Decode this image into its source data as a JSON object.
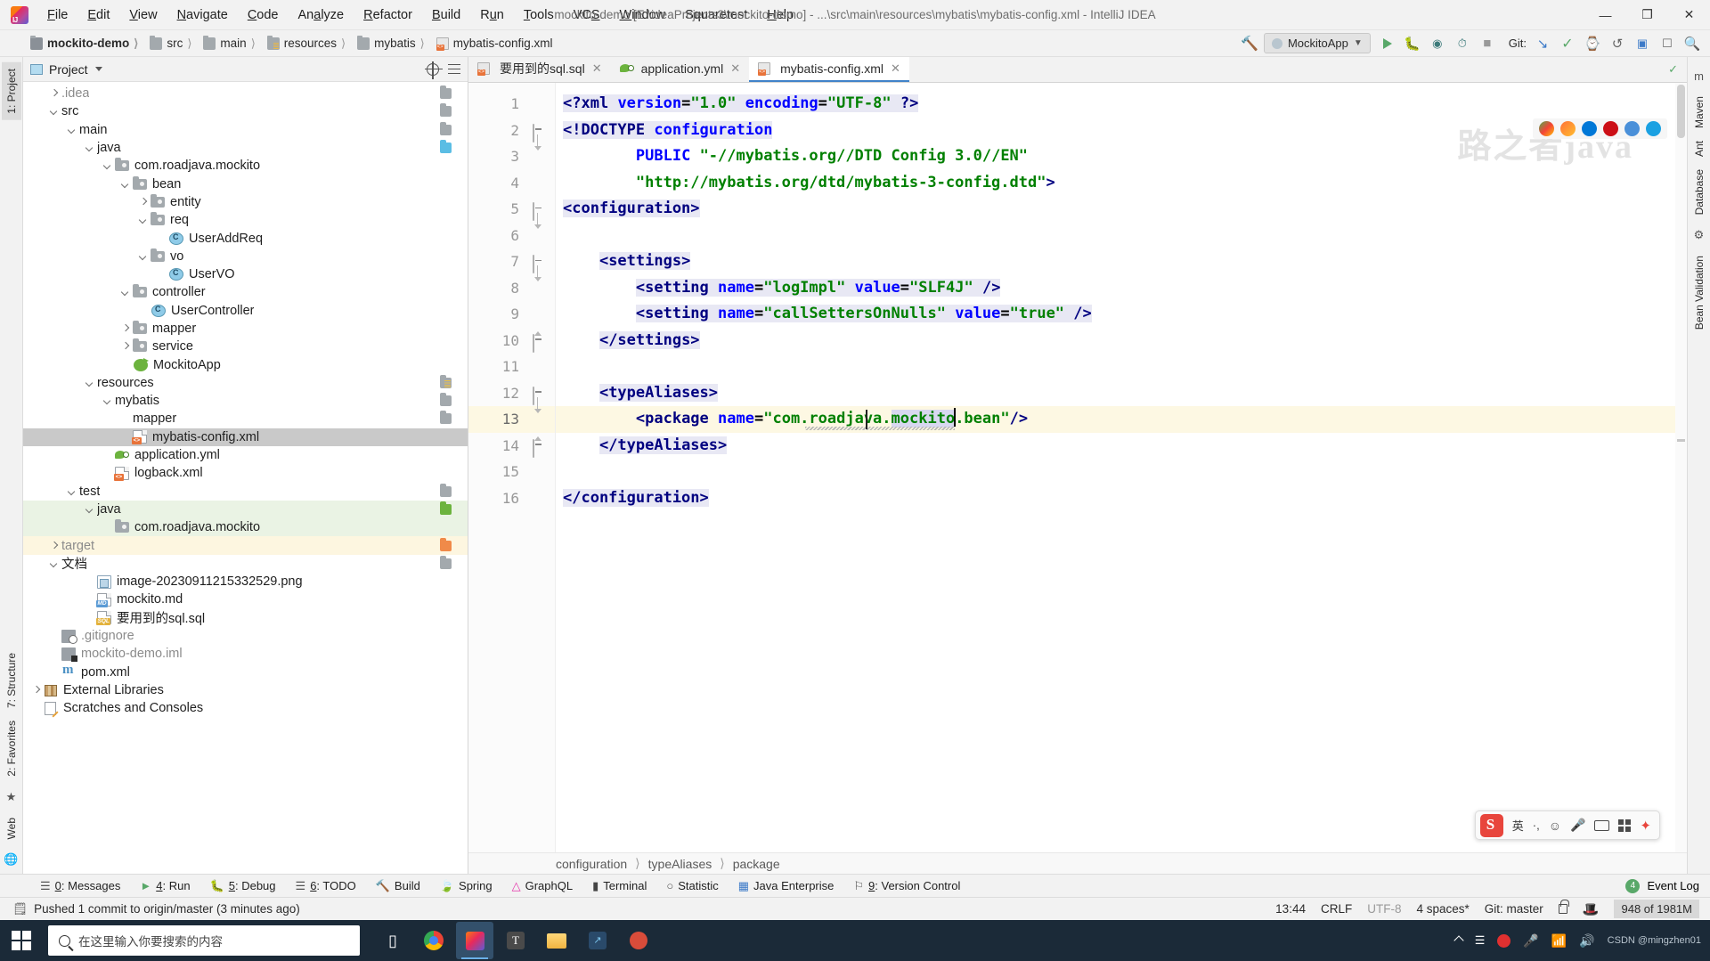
{
  "window": {
    "title": "mockito-demo [E:\\ideaProjects3\\mockito-demo] - ...\\src\\main\\resources\\mybatis\\mybatis-config.xml - IntelliJ IDEA",
    "minimize": "—",
    "maximize": "❐",
    "close": "✕"
  },
  "menu": [
    {
      "label": "File",
      "mnemonic": "F"
    },
    {
      "label": "Edit",
      "mnemonic": "E"
    },
    {
      "label": "View",
      "mnemonic": "V"
    },
    {
      "label": "Navigate",
      "mnemonic": "N"
    },
    {
      "label": "Code",
      "mnemonic": "C"
    },
    {
      "label": "Analyze",
      "mnemonic": "A"
    },
    {
      "label": "Refactor",
      "mnemonic": "R"
    },
    {
      "label": "Build",
      "mnemonic": "B"
    },
    {
      "label": "Run",
      "mnemonic": "u"
    },
    {
      "label": "Tools",
      "mnemonic": "T"
    },
    {
      "label": "VCS",
      "mnemonic": "S"
    },
    {
      "label": "Window",
      "mnemonic": "W"
    },
    {
      "label": "Squaretest",
      "mnemonic": ""
    },
    {
      "label": "Help",
      "mnemonic": "H"
    }
  ],
  "breadcrumb_top": [
    {
      "label": "mockito-demo",
      "icon": "folder-module-icon"
    },
    {
      "label": "src",
      "icon": "folder-icon"
    },
    {
      "label": "main",
      "icon": "folder-icon"
    },
    {
      "label": "resources",
      "icon": "folder-resources-icon"
    },
    {
      "label": "mybatis",
      "icon": "folder-icon"
    },
    {
      "label": "mybatis-config.xml",
      "icon": "xml-file-icon"
    }
  ],
  "toolbar": {
    "run_config": "MockitoApp",
    "git_label": "Git:",
    "run_tooltip": "Run",
    "debug_tooltip": "Debug",
    "stop_tooltip": "Stop",
    "update_tooltip": "Update Project",
    "commit_tooltip": "Commit",
    "history_tooltip": "History",
    "rollback_tooltip": "Rollback",
    "search_tooltip": "Search Everywhere"
  },
  "left_strip": [
    {
      "label": "1: Project",
      "active": true
    },
    {
      "label": "7: Structure",
      "active": false
    },
    {
      "label": "2: Favorites",
      "active": false
    },
    {
      "label": "Web",
      "active": false
    }
  ],
  "right_strip": [
    {
      "label": "Maven"
    },
    {
      "label": "Ant"
    },
    {
      "label": "Database"
    },
    {
      "label": "Bean Validation"
    }
  ],
  "project_panel": {
    "title": "Project",
    "select_target_icon": "crosshair-icon",
    "collapse_all_icon": "collapse-all-icon"
  },
  "tree": [
    {
      "label": ".idea",
      "indent": 1,
      "arrow": "right",
      "icon": "folder",
      "style": "muted"
    },
    {
      "label": "src",
      "indent": 1,
      "arrow": "down",
      "icon": "folder"
    },
    {
      "label": "main",
      "indent": 2,
      "arrow": "down",
      "icon": "folder"
    },
    {
      "label": "java",
      "indent": 3,
      "arrow": "down",
      "icon": "folder-java"
    },
    {
      "label": "com.roadjava.mockito",
      "indent": 4,
      "arrow": "down",
      "icon": "package"
    },
    {
      "label": "bean",
      "indent": 5,
      "arrow": "down",
      "icon": "package"
    },
    {
      "label": "entity",
      "indent": 6,
      "arrow": "right",
      "icon": "package"
    },
    {
      "label": "req",
      "indent": 6,
      "arrow": "down",
      "icon": "package"
    },
    {
      "label": "UserAddReq",
      "indent": 7,
      "arrow": "none",
      "icon": "class"
    },
    {
      "label": "vo",
      "indent": 6,
      "arrow": "down",
      "icon": "package"
    },
    {
      "label": "UserVO",
      "indent": 7,
      "arrow": "none",
      "icon": "class"
    },
    {
      "label": "controller",
      "indent": 5,
      "arrow": "down",
      "icon": "package"
    },
    {
      "label": "UserController",
      "indent": 6,
      "arrow": "none",
      "icon": "class"
    },
    {
      "label": "mapper",
      "indent": 5,
      "arrow": "right",
      "icon": "package"
    },
    {
      "label": "service",
      "indent": 5,
      "arrow": "right",
      "icon": "package"
    },
    {
      "label": "MockitoApp",
      "indent": 5,
      "arrow": "none",
      "icon": "spring-class"
    },
    {
      "label": "resources",
      "indent": 3,
      "arrow": "down",
      "icon": "folder-resources"
    },
    {
      "label": "mybatis",
      "indent": 4,
      "arrow": "down",
      "icon": "folder"
    },
    {
      "label": "mapper",
      "indent": 5,
      "arrow": "none",
      "icon": "folder"
    },
    {
      "label": "mybatis-config.xml",
      "indent": 5,
      "arrow": "none",
      "icon": "xml-file",
      "selected": true
    },
    {
      "label": "application.yml",
      "indent": 4,
      "arrow": "none",
      "icon": "yml-file"
    },
    {
      "label": "logback.xml",
      "indent": 4,
      "arrow": "none",
      "icon": "xml-file"
    },
    {
      "label": "test",
      "indent": 2,
      "arrow": "down",
      "icon": "folder"
    },
    {
      "label": "java",
      "indent": 3,
      "arrow": "down",
      "icon": "folder-testjava",
      "rowstyle": "testsrc"
    },
    {
      "label": "com.roadjava.mockito",
      "indent": 4,
      "arrow": "none",
      "icon": "package",
      "rowstyle": "testsrc"
    },
    {
      "label": "target",
      "indent": 1,
      "arrow": "right",
      "icon": "folder-orange",
      "rowstyle": "targetdir",
      "style": "muted"
    },
    {
      "label": "文档",
      "indent": 1,
      "arrow": "down",
      "icon": "folder"
    },
    {
      "label": "image-20230911215332529.png",
      "indent": 3,
      "arrow": "none",
      "icon": "png-file"
    },
    {
      "label": "mockito.md",
      "indent": 3,
      "arrow": "none",
      "icon": "md-file"
    },
    {
      "label": "要用到的sql.sql",
      "indent": 3,
      "arrow": "none",
      "icon": "sql-file"
    },
    {
      "label": ".gitignore",
      "indent": 1,
      "arrow": "none",
      "icon": "git-file",
      "style": "muted"
    },
    {
      "label": "mockito-demo.iml",
      "indent": 1,
      "arrow": "none",
      "icon": "iml-file",
      "style": "muted"
    },
    {
      "label": "pom.xml",
      "indent": 1,
      "arrow": "none",
      "icon": "maven-file"
    },
    {
      "label": "External Libraries",
      "indent": 0,
      "arrow": "right",
      "icon": "library"
    },
    {
      "label": "Scratches and Consoles",
      "indent": 0,
      "arrow": "none",
      "icon": "scratch"
    }
  ],
  "editor_tabs": [
    {
      "label": "要用到的sql.sql",
      "icon": "sql-file-icon",
      "active": false
    },
    {
      "label": "application.yml",
      "icon": "yml-file-icon",
      "active": false
    },
    {
      "label": "mybatis-config.xml",
      "icon": "xml-file-icon",
      "active": true
    }
  ],
  "code": {
    "line_numbers": [
      1,
      2,
      3,
      4,
      5,
      6,
      7,
      8,
      9,
      10,
      11,
      12,
      13,
      14,
      15,
      16
    ],
    "lines": [
      {
        "n": 1,
        "text": "<?xml version=\"1.0\" encoding=\"UTF-8\" ?>"
      },
      {
        "n": 2,
        "text": "<!DOCTYPE configuration"
      },
      {
        "n": 3,
        "text": "        PUBLIC \"-//mybatis.org//DTD Config 3.0//EN\""
      },
      {
        "n": 4,
        "text": "        \"http://mybatis.org/dtd/mybatis-3-config.dtd\">"
      },
      {
        "n": 5,
        "text": "<configuration>"
      },
      {
        "n": 6,
        "text": ""
      },
      {
        "n": 7,
        "text": "    <settings>"
      },
      {
        "n": 8,
        "text": "        <setting name=\"logImpl\" value=\"SLF4J\" />"
      },
      {
        "n": 9,
        "text": "        <setting name=\"callSettersOnNulls\" value=\"true\" />"
      },
      {
        "n": 10,
        "text": "    </settings>"
      },
      {
        "n": 11,
        "text": ""
      },
      {
        "n": 12,
        "text": "    <typeAliases>"
      },
      {
        "n": 13,
        "text": "        <package name=\"com.roadjava.mockito.bean\"/>"
      },
      {
        "n": 14,
        "text": "    </typeAliases>"
      },
      {
        "n": 15,
        "text": ""
      },
      {
        "n": 16,
        "text": "</configuration>"
      }
    ],
    "current_line": 13,
    "caret_after": "com.roadjava.mockito",
    "selection": "mockito"
  },
  "editor_breadcrumb": [
    "configuration",
    "typeAliases",
    "package"
  ],
  "watermark": "路之者java",
  "ime": {
    "lang": "英",
    "punct": "·,",
    "emoji_icon": "smiley-icon",
    "mic_icon": "microphone-icon",
    "keyboard_icon": "keyboard-icon",
    "apps_icon": "apps-grid-icon",
    "settings_icon": "ime-settings-icon"
  },
  "bottom_tools": [
    {
      "label": "0: Messages",
      "mnemonic": "0",
      "icon": "messages-icon"
    },
    {
      "label": "4: Run",
      "mnemonic": "4",
      "icon": "run-icon"
    },
    {
      "label": "5: Debug",
      "mnemonic": "5",
      "icon": "debug-icon"
    },
    {
      "label": "6: TODO",
      "mnemonic": "6",
      "icon": "todo-icon"
    },
    {
      "label": "Build",
      "mnemonic": "",
      "icon": "build-icon"
    },
    {
      "label": "Spring",
      "mnemonic": "",
      "icon": "spring-icon"
    },
    {
      "label": "GraphQL",
      "mnemonic": "",
      "icon": "graphql-icon"
    },
    {
      "label": "Terminal",
      "mnemonic": "",
      "icon": "terminal-icon"
    },
    {
      "label": "Statistic",
      "mnemonic": "",
      "icon": "statistic-icon"
    },
    {
      "label": "Java Enterprise",
      "mnemonic": "",
      "icon": "java-enterprise-icon"
    },
    {
      "label": "9: Version Control",
      "mnemonic": "9",
      "icon": "version-control-icon"
    }
  ],
  "event_log": {
    "label": "Event Log",
    "count": "4"
  },
  "statusbar": {
    "message": "Pushed 1 commit to origin/master (3 minutes ago)",
    "time": "13:44",
    "line_separator": "CRLF",
    "encoding": "UTF-8",
    "indent": "4 spaces*",
    "branch": "Git: master",
    "lock_icon": "unlock-icon",
    "hat_icon": "hector-inspection-icon",
    "memory": "948 of 1981M"
  },
  "taskbar": {
    "search_placeholder": "在这里输入你要搜索的内容",
    "start_icon": "windows-start-icon",
    "apps": [
      {
        "name": "task-view-icon"
      },
      {
        "name": "chrome-icon"
      },
      {
        "name": "intellij-idea-icon"
      },
      {
        "name": "typora-icon"
      },
      {
        "name": "file-explorer-icon"
      },
      {
        "name": "xshell-icon"
      },
      {
        "name": "navicat-icon"
      }
    ],
    "tray": {
      "up_chevron": "show-hidden-icons",
      "record": "recording-icon",
      "mic": "microphone-icon",
      "network": "network-icon",
      "volume": "volume-icon",
      "ime": "ime-indicator"
    },
    "watermark": "CSDN @mingzhen01"
  }
}
